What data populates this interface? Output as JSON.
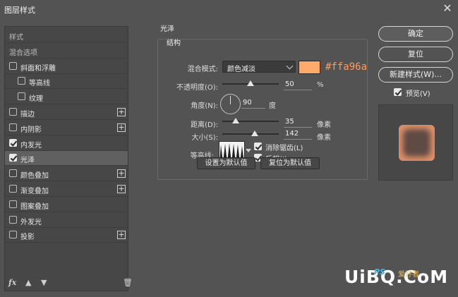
{
  "window": {
    "title": "图层样式",
    "close_glyph": "✕"
  },
  "left_panel": {
    "items": [
      {
        "label": "样式",
        "checkbox": null,
        "plus": false,
        "indent": 0,
        "selected": false
      },
      {
        "label": "混合选项",
        "checkbox": null,
        "plus": false,
        "indent": 0,
        "selected": false
      },
      {
        "label": "斜面和浮雕",
        "checkbox": false,
        "plus": false,
        "indent": 0,
        "selected": false
      },
      {
        "label": "等高线",
        "checkbox": false,
        "plus": false,
        "indent": 1,
        "selected": false
      },
      {
        "label": "纹理",
        "checkbox": false,
        "plus": false,
        "indent": 1,
        "selected": false
      },
      {
        "label": "描边",
        "checkbox": false,
        "plus": true,
        "indent": 0,
        "selected": false
      },
      {
        "label": "内阴影",
        "checkbox": false,
        "plus": true,
        "indent": 0,
        "selected": false
      },
      {
        "label": "内发光",
        "checkbox": true,
        "plus": false,
        "indent": 0,
        "selected": false
      },
      {
        "label": "光泽",
        "checkbox": true,
        "plus": false,
        "indent": 0,
        "selected": true
      },
      {
        "label": "颜色叠加",
        "checkbox": false,
        "plus": true,
        "indent": 0,
        "selected": false
      },
      {
        "label": "渐变叠加",
        "checkbox": false,
        "plus": true,
        "indent": 0,
        "selected": false
      },
      {
        "label": "图案叠加",
        "checkbox": false,
        "plus": false,
        "indent": 0,
        "selected": false
      },
      {
        "label": "外发光",
        "checkbox": false,
        "plus": false,
        "indent": 0,
        "selected": false
      },
      {
        "label": "投影",
        "checkbox": false,
        "plus": true,
        "indent": 0,
        "selected": false
      }
    ],
    "footer": {
      "fx": "fx",
      "up": "▲",
      "down": "▼",
      "trash": "🗑"
    },
    "plus_glyph": "+"
  },
  "satin": {
    "section_title": "光泽",
    "group_title": "结构",
    "blend_mode": {
      "label": "混合模式:",
      "value": "颜色减淡"
    },
    "color": {
      "hex": "#ffa96a",
      "label": "#ffa96a"
    },
    "opacity": {
      "label": "不透明度(O):",
      "value": "50",
      "unit": "%",
      "fraction": 0.5
    },
    "angle": {
      "label": "角度(N):",
      "value": "90",
      "unit": "度"
    },
    "distance": {
      "label": "距离(D):",
      "value": "35",
      "unit": "像素",
      "fraction": 0.24
    },
    "size": {
      "label": "大小(S):",
      "value": "142",
      "unit": "像素",
      "fraction": 0.57
    },
    "contour_label": "等高线:",
    "anti_alias": {
      "label": "消除锯齿(L)",
      "checked": true
    },
    "invert": {
      "label": "反相(I)",
      "checked": true
    },
    "make_default": "设置为默认值",
    "reset_default": "复位为默认值"
  },
  "actions": {
    "ok": "确定",
    "reset": "复位",
    "new_style": "新建样式(W)...",
    "preview": {
      "label": "预览(V)",
      "checked": true
    }
  },
  "watermark": {
    "main": "UiBQ.CoM",
    "ps": "PS",
    "site": "爱好者"
  }
}
